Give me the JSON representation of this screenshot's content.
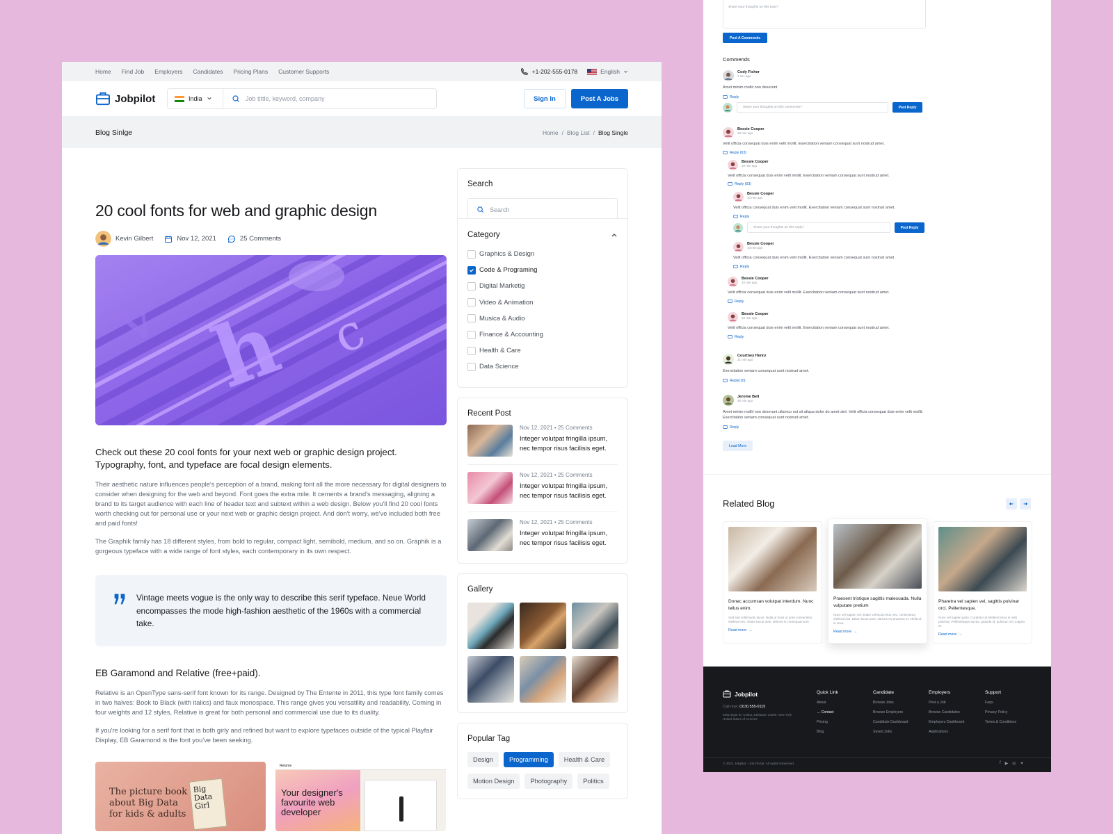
{
  "topbar": {
    "nav": [
      "Home",
      "Find Job",
      "Employers",
      "Candidates",
      "Pricing Plans",
      "Customer Supports"
    ],
    "phone": "+1-202-555-0178",
    "language": "English"
  },
  "header": {
    "logo": "Jobpilot",
    "country": "India",
    "search_placeholder": "Job tittle, keyword, company",
    "sign_in": "Sign In",
    "post_job": "Post A Jobs"
  },
  "breadcrumb": {
    "page_title": "Blog Sinlge",
    "items": [
      "Home",
      "/",
      "Blog List",
      "/",
      "Blog Single"
    ]
  },
  "article": {
    "title": "20 cool fonts for web and graphic design",
    "author": "Kevin Gilbert",
    "date": "Nov 12, 2021",
    "comments": "25 Comments",
    "lead": "Check out these 20 cool fonts for your next web or graphic design project. Typography, font, and typeface are focal design elements.",
    "p1": "Their aesthetic nature influences people's perception of a brand, making font all the more necessary for digital designers to consider when designing for the web and beyond. Font goes the extra mile. It cements a brand's messaging, aligning a brand to its target audience with each line of header text and subtext within a web design. Below you'll find 20 cool fonts worth checking out for personal use or your next web or graphic design project. And don't worry, we've included both free and paid fonts!",
    "p2": "The Graphik family has 18 different styles, from bold to regular, compact light, semibold, medium, and so on. Graphik is a gorgeous typeface with a wide range of font styles, each contemporary in its own respect.",
    "quote": "Vintage meets vogue is the only way to describe this serif typeface. Neue World encompasses the mode high-fashion aesthetic of the 1960s with a commercial take.",
    "h2": "EB Garamond and Relative (free+paid).",
    "p3": "Relative is an OpenType sans-serif font known for its range. Designed by The Entente in 2011, this type font family comes in two halves: Book to Black (with italics) and faux monospace. This range gives you versatility and readability. Coming in four weights and 12 styles, Relative is great for both personal and commercial use due to its duality.",
    "p4": "If you're looking for a serif font that is both girly and refined but want to explore typefaces outside of the typical Playfair Display, EB Garamond is the font you've been seeking.",
    "img1_text": "The picture book about Big Data for kids & adults",
    "img1_book": "Big Data Girl",
    "img2_text": "Your designer's favourite web developer",
    "img2_brand": "Relume"
  },
  "sidebar": {
    "search_title": "Search",
    "search_placeholder": "Search",
    "category_title": "Category",
    "categories": [
      {
        "label": "Graphics & Design",
        "checked": false
      },
      {
        "label": "Code & Programing",
        "checked": true
      },
      {
        "label": "Digital Marketig",
        "checked": false
      },
      {
        "label": "Video & Animation",
        "checked": false
      },
      {
        "label": "Musica & Audio",
        "checked": false
      },
      {
        "label": "Finance & Accounting",
        "checked": false
      },
      {
        "label": "Health & Care",
        "checked": false
      },
      {
        "label": "Data Science",
        "checked": false
      }
    ],
    "recent_title": "Recent Post",
    "recent": [
      {
        "date": "Nov 12, 2021",
        "comments": "25 Comments",
        "title": "Integer volutpat fringilla ipsum, nec tempor risus facilisis eget."
      },
      {
        "date": "Nov 12, 2021",
        "comments": "25 Comments",
        "title": "Integer volutpat fringilla ipsum, nec tempor risus facilisis eget."
      },
      {
        "date": "Nov 12, 2021",
        "comments": "25 Comments",
        "title": "Integer volutpat fringilla ipsum, nec tempor risus facilisis eget."
      }
    ],
    "gallery_title": "Gallery",
    "tags_title": "Popular Tag",
    "tags": [
      {
        "label": "Design",
        "active": false
      },
      {
        "label": "Programming",
        "active": true
      },
      {
        "label": "Health & Care",
        "active": false
      },
      {
        "label": "Motion Design",
        "active": false
      },
      {
        "label": "Photography",
        "active": false
      },
      {
        "label": "Politics",
        "active": false
      }
    ]
  },
  "comments": {
    "top_placeholder": "Share your thoughts on this post?",
    "post_button": "Post A Commends",
    "title": "Commends",
    "reply_placeholder": "Share your thoughts on this comments?",
    "reply_placeholder2": "Share your thoughts on this reply?",
    "post_reply": "Post Reply",
    "load_more": "Load More",
    "list": [
      {
        "name": "Cody Fisher",
        "time": "1 sec ago",
        "text": "Amet minim mollit non deserunt",
        "reply": "Reply"
      },
      {
        "name": "Bessie Cooper",
        "time": "10 min ago",
        "text": "Velit officia consequat duis enim velit mollit. Exercitation veniam consequat sunt nostrud amet.",
        "reply": "Reply (03)"
      },
      {
        "name": "Bessie Cooper",
        "time": "10 min ago",
        "text": "Velit officia consequat duis enim velit mollit. Exercitation veniam consequat sunt nostrud amet.",
        "reply": "Reply (03)"
      },
      {
        "name": "Bessie Cooper",
        "time": "10 min ago",
        "text": "Velit officia consequat duis enim velit mollit. Exercitation veniam consequat sunt nostrud amet.",
        "reply": "Reply"
      },
      {
        "name": "Bessie Cooper",
        "time": "10 min ago",
        "text": "Velit officia consequat duis enim velit mollit. Exercitation veniam consequat sunt nostrud amet.",
        "reply": "Reply"
      },
      {
        "name": "Bessie Cooper",
        "time": "10 min ago",
        "text": "Velit officia consequat duis enim velit mollit. Exercitation veniam consequat sunt nostrud amet.",
        "reply": "Reply"
      },
      {
        "name": "Bessie Cooper",
        "time": "10 min ago",
        "text": "Velit officia consequat duis enim velit mollit. Exercitation veniam consequat sunt nostrud amet.",
        "reply": "Reply"
      },
      {
        "name": "Courtney Henry",
        "time": "21 min ago",
        "text": "Exercitation veniam consequat sunt nostrud amet.",
        "reply": "Reply(10)"
      },
      {
        "name": "Jerome Bell",
        "time": "30 min ago",
        "text": "Amet minim mollit non deserunt ullamco est sit aliqua dolor do amet sint. Velit officia consequat duis enim velit mollit. Exercitation veniam consequat sunt nostrud amet.",
        "reply": "Reply"
      }
    ]
  },
  "related": {
    "title": "Related Blog",
    "cards": [
      {
        "title": "Donec accumsan volutpat interdum. Nunc tellus enim.",
        "excerpt": "Sed sed sollicitudin lacus. Nulla ut risus ut ante consectetur eleifend nec. Etiam lacus ante, ultrices in consequat sem.",
        "more": "Read more"
      },
      {
        "title": "Praesent tristique sagittis malesuada. Nulla vulputate pretium",
        "excerpt": "Nunc vel sapien vel. Etiam vehicula risus nec, consectetur eleifend nisi. Etiam lacus ante, ultrices eu pharetra et, eleifend in urna.",
        "more": "Read more"
      },
      {
        "title": "Pharetra vel sapien vel, sagittis pulvinar orci. Pellentesque.",
        "excerpt": "Nunc vel sapien justo. Curabitur at eleifend risus in velit pulvinar. Pellentesque auctor, gravida id, pulvinar orci magna et.",
        "more": "Read more"
      }
    ]
  },
  "footer": {
    "logo": "Jobpilot",
    "call_label": "Call now:",
    "call_number": "(319) 555-0115",
    "address": "6391 Elgin St. Celina, Delaware 10299, New York, United States of America",
    "quick_title": "Quick Link",
    "quick": [
      "About",
      "Contact",
      "Pricing",
      "Blog"
    ],
    "cand_title": "Candidate",
    "cand": [
      "Browse Jobs",
      "Browse Employers",
      "Candidate Dashboard",
      "Saved Jobs"
    ],
    "emp_title": "Employers",
    "emp": [
      "Post a Job",
      "Browse Candidates",
      "Employers Dashboard",
      "Applications"
    ],
    "sup_title": "Support",
    "sup": [
      "Faqs",
      "Privacy Policy",
      "Terms & Conditions"
    ],
    "copyright": "© 2021 Jobpilot - Job Portal. All rights Reserved"
  },
  "colors": {
    "primary": "#0a65cc",
    "background": "#e6b8de",
    "footer": "#18191c"
  }
}
